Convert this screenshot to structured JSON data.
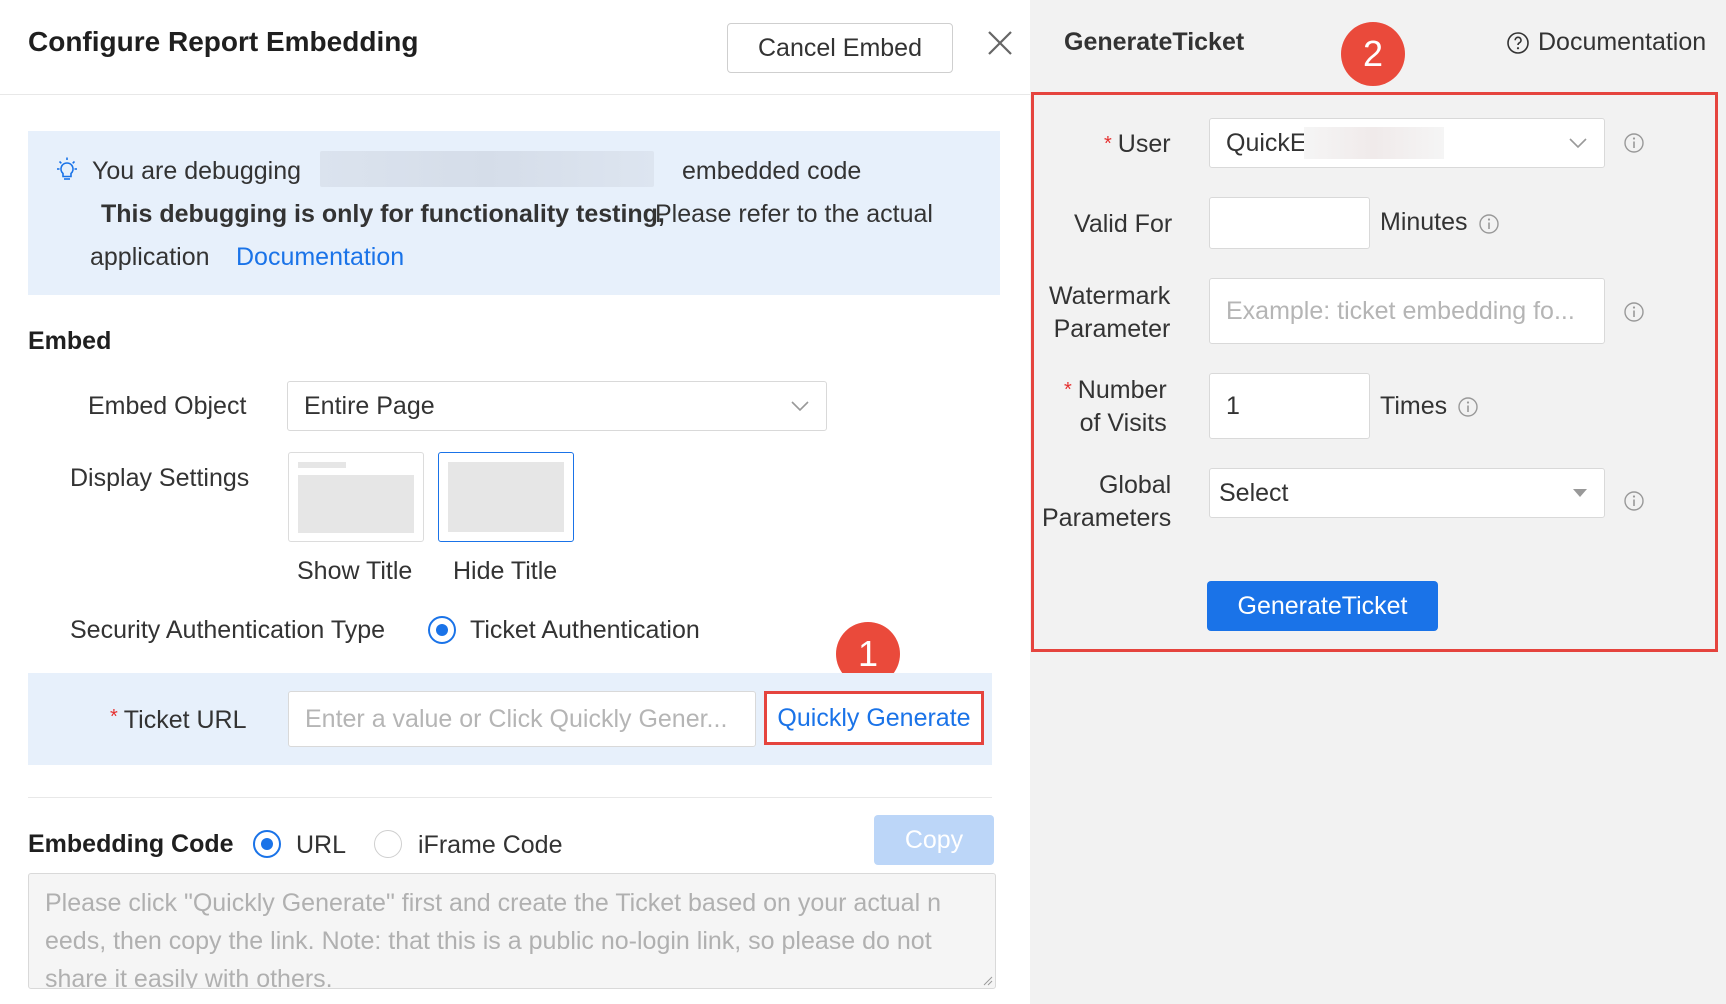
{
  "dialog": {
    "title": "Configure Report Embedding",
    "cancel_label": "Cancel Embed"
  },
  "notice": {
    "prefix": "You are debugging",
    "suffix": "embedded code",
    "bold_text": "This debugging is only for functionality testing,",
    "rest_text": "Please refer to the actual",
    "line3_text": "application",
    "doc_link": "Documentation"
  },
  "embed": {
    "section_title": "Embed",
    "object_label": "Embed Object",
    "object_value": "Entire Page",
    "display_label": "Display Settings",
    "show_title_label": "Show Title",
    "hide_title_label": "Hide Title",
    "selected_display": "Hide Title",
    "auth_label": "Security Authentication Type",
    "auth_option": "Ticket Authentication",
    "ticket_label": "Ticket URL",
    "ticket_placeholder": "Enter a value or Click Quickly Gener...",
    "quick_generate_label": "Quickly Generate"
  },
  "code": {
    "section_title": "Embedding Code",
    "option_url": "URL",
    "option_iframe": "iFrame Code",
    "selected": "URL",
    "copy_label": "Copy",
    "placeholder": "Please click \"Quickly Generate\" first and create the Ticket based on your actual n eeds, then copy the link. Note: that this is a public no-login link, so please do not share it easily with others."
  },
  "badges": {
    "one": "1",
    "two": "2"
  },
  "ticket_panel": {
    "title": "GenerateTicket",
    "doc_label": "Documentation",
    "user_label": "User",
    "user_value": "QuickE",
    "valid_label": "Valid For",
    "valid_value": "",
    "valid_unit": "Minutes",
    "watermark_label_1": "Watermark",
    "watermark_label_2": "Parameter",
    "watermark_placeholder": "Example: ticket embedding fo...",
    "visits_label_1": "Number",
    "visits_label_2": "of Visits",
    "visits_value": "1",
    "visits_unit": "Times",
    "global_label_1": "Global",
    "global_label_2": "Parameters",
    "global_value": "Select",
    "generate_label": "GenerateTicket"
  },
  "colors": {
    "accent": "#1a73e8",
    "highlight_border": "#e5443e",
    "badge": "#ea4a3b",
    "notice_bg": "#e7f0fb",
    "required": "#e5302f"
  }
}
